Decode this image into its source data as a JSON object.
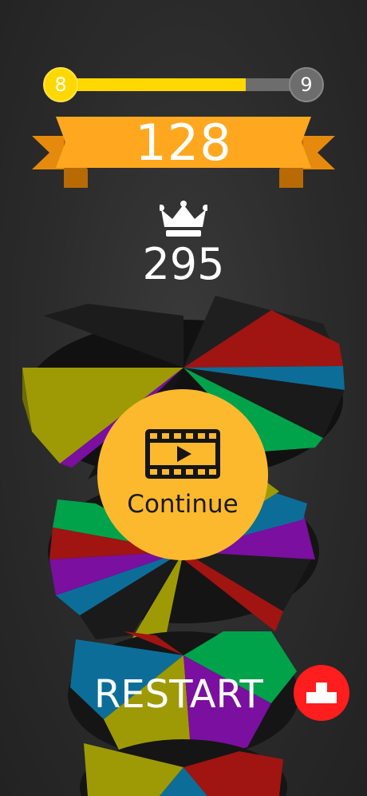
{
  "progress": {
    "current_level": "8",
    "next_level": "9",
    "fraction": 0.75
  },
  "score": "128",
  "best": {
    "icon": "crown-icon",
    "value": "295"
  },
  "continue_button": {
    "icon": "video-play-icon",
    "label": "Continue"
  },
  "restart_button": {
    "label": "RESTART",
    "icon": "leaderboard-podium-icon"
  },
  "colors": {
    "level_fill": "#ffd800",
    "ribbon": "#ffa81f",
    "continue_bg": "#fdb92d",
    "restart_icon_bg": "#ff1d1d",
    "pie_colors": [
      "#1c1c1c",
      "#9b1311",
      "#0c6e98",
      "#00a24a",
      "#7a0fa0",
      "#9e9a05"
    ]
  }
}
